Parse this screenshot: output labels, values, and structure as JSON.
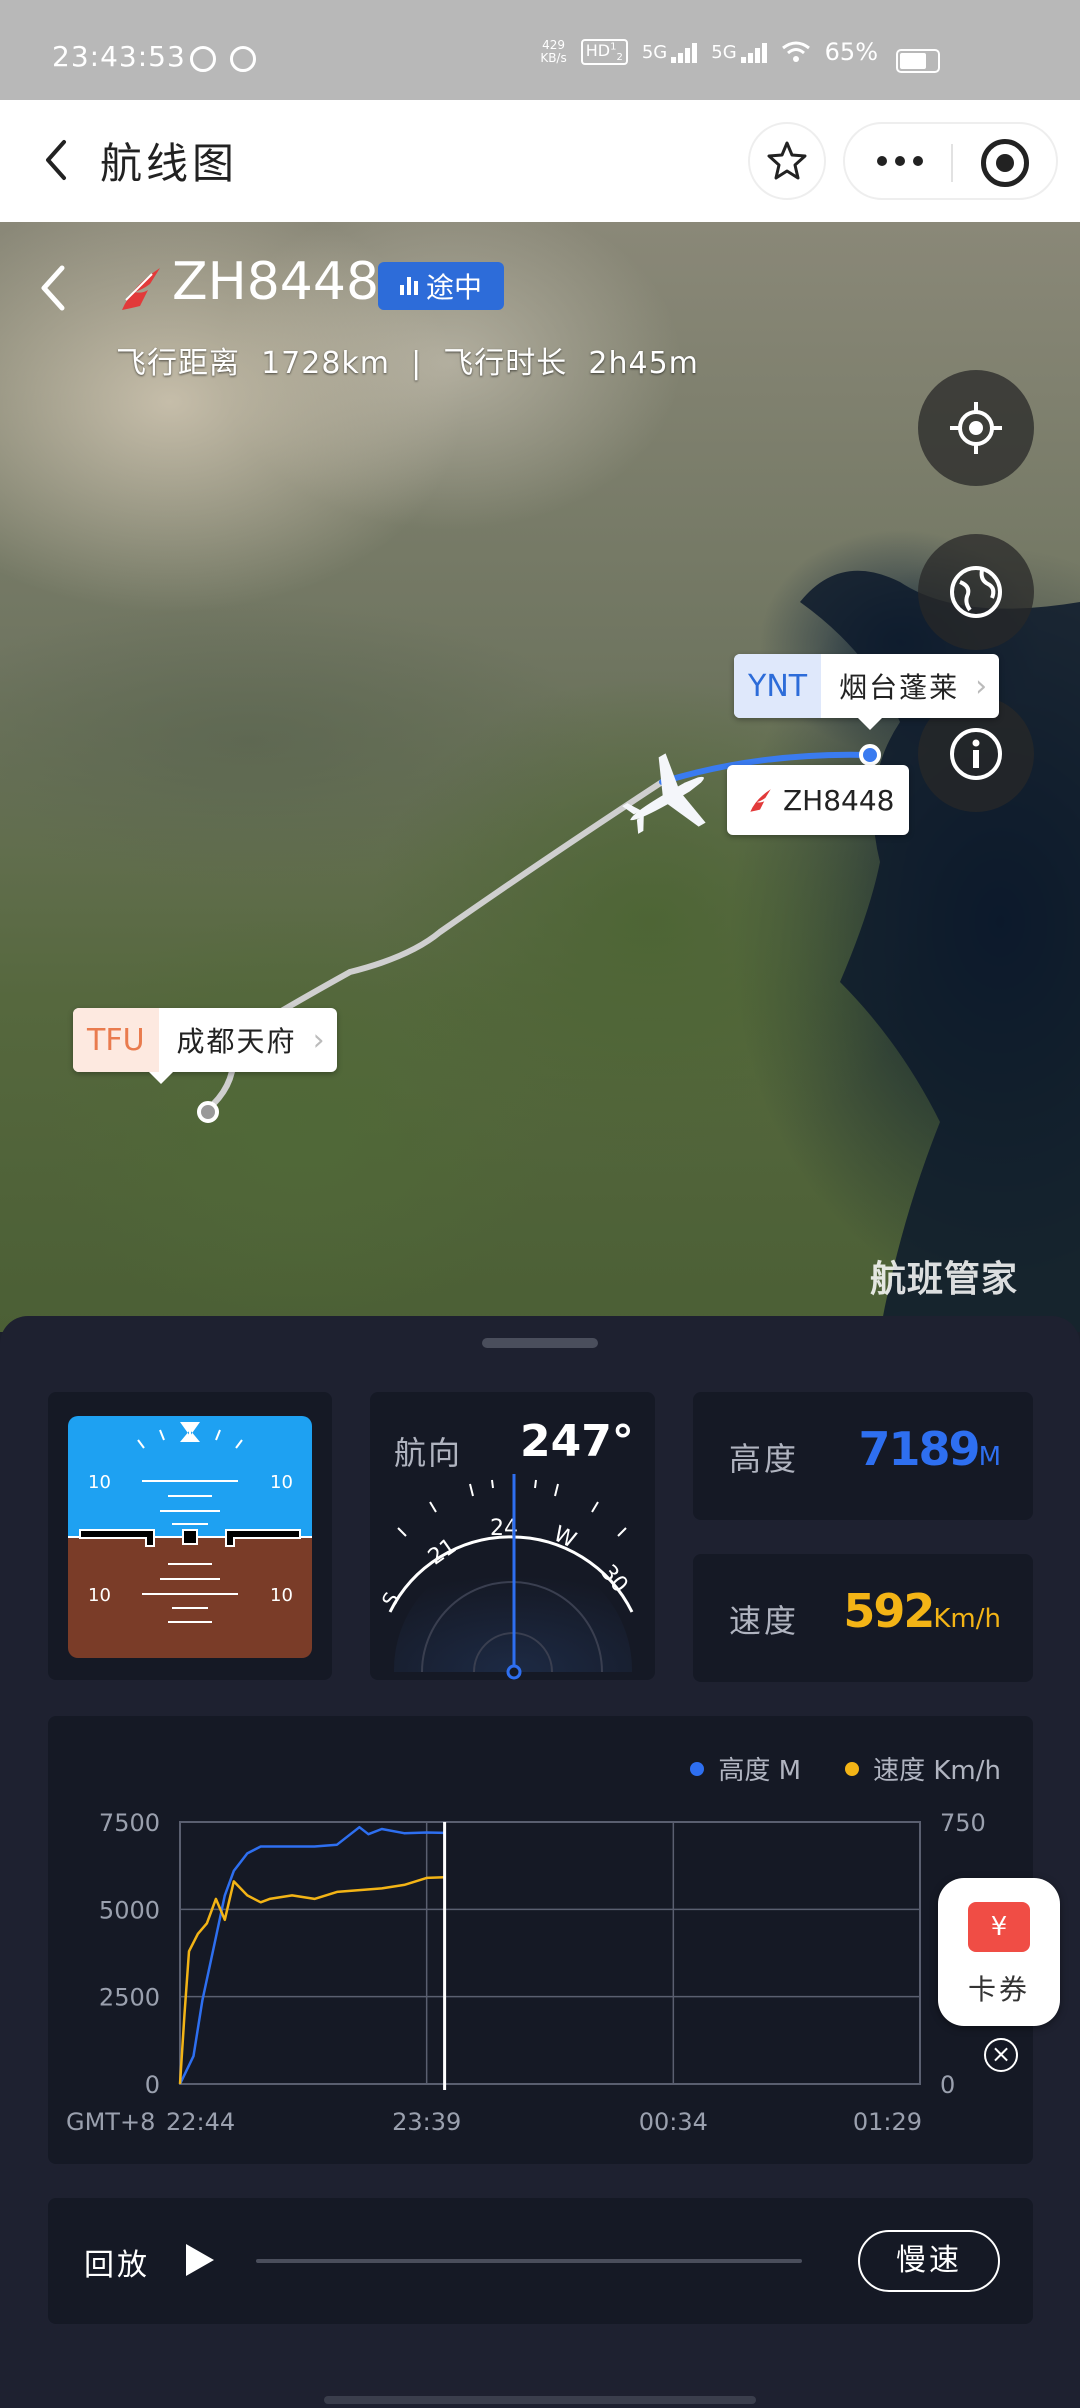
{
  "status_bar": {
    "time": "23:43:53",
    "net_speed_value": "429",
    "net_speed_unit": "KB/s",
    "hd": "HD",
    "hd_sub": "1",
    "hd_sub2": "2",
    "sim1": "5G",
    "sim2": "5G",
    "battery": "65%"
  },
  "header": {
    "title": "航线图",
    "favorite_icon": "star-icon",
    "more_icon": "more-dots-icon",
    "close_icon": "target-circle-icon"
  },
  "flight": {
    "number": "ZH8448",
    "status": "途中",
    "distance_label": "飞行距离",
    "distance": "1728km",
    "separator": "|",
    "duration_label": "飞行时长",
    "duration": "2h45m",
    "progress": 0.33
  },
  "map": {
    "origin": {
      "code": "TFU",
      "name": "成都天府"
    },
    "destination": {
      "code": "YNT",
      "name": "烟台蓬莱"
    },
    "plane_label": "ZH8448",
    "watermark": "航班管家",
    "buttons": [
      "locate-icon",
      "globe-icon",
      "info-icon"
    ],
    "route_color": "#cfcfcf",
    "remaining_color": "#3a7bf0"
  },
  "instruments": {
    "attitude": {
      "pitch_marks": [
        "10",
        "10",
        "10",
        "10"
      ]
    },
    "heading": {
      "label": "航向",
      "value": "247°",
      "ticks": [
        "S",
        "21",
        "24",
        "W",
        "30"
      ]
    },
    "altitude": {
      "label": "高度",
      "value": "7189",
      "unit": "M"
    },
    "speed": {
      "label": "速度",
      "value": "592",
      "unit": "Km/h"
    }
  },
  "chart_data": {
    "type": "line",
    "legend": [
      {
        "name": "高度 M",
        "color": "#2e6ff0"
      },
      {
        "name": "速度 Km/h",
        "color": "#f3b416"
      }
    ],
    "x_prefix": "GMT+8",
    "x_ticks": [
      "22:44",
      "23:39",
      "00:34",
      "01:29"
    ],
    "y_left_ticks": [
      "7500",
      "5000",
      "2500",
      "0"
    ],
    "y_right_ticks": [
      "750",
      "0"
    ],
    "ylim_left": [
      0,
      7500
    ],
    "ylim_right": [
      0,
      750
    ],
    "xlim_minutes": [
      0,
      165
    ],
    "current_minute": 59,
    "series": [
      {
        "name": "高度 M",
        "color": "#2e6ff0",
        "x": [
          0,
          3,
          5,
          8,
          10,
          12,
          15,
          18,
          20,
          25,
          30,
          35,
          40,
          42,
          45,
          50,
          55,
          59
        ],
        "y": [
          0,
          800,
          2400,
          4200,
          5400,
          6100,
          6600,
          6800,
          6800,
          6800,
          6800,
          6850,
          7350,
          7150,
          7300,
          7180,
          7200,
          7189
        ]
      },
      {
        "name": "速度 Km/h",
        "color": "#f3b416",
        "x": [
          0,
          1,
          2,
          4,
          6,
          8,
          10,
          12,
          15,
          18,
          20,
          25,
          30,
          35,
          40,
          45,
          50,
          55,
          59
        ],
        "y": [
          0,
          200,
          380,
          430,
          460,
          530,
          470,
          580,
          540,
          520,
          530,
          540,
          530,
          550,
          555,
          560,
          570,
          590,
          592
        ]
      }
    ]
  },
  "coupon": {
    "label": "卡券",
    "icon_text": "¥",
    "close": "×"
  },
  "replay": {
    "label": "回放",
    "speed_button": "慢速",
    "progress": 0
  }
}
